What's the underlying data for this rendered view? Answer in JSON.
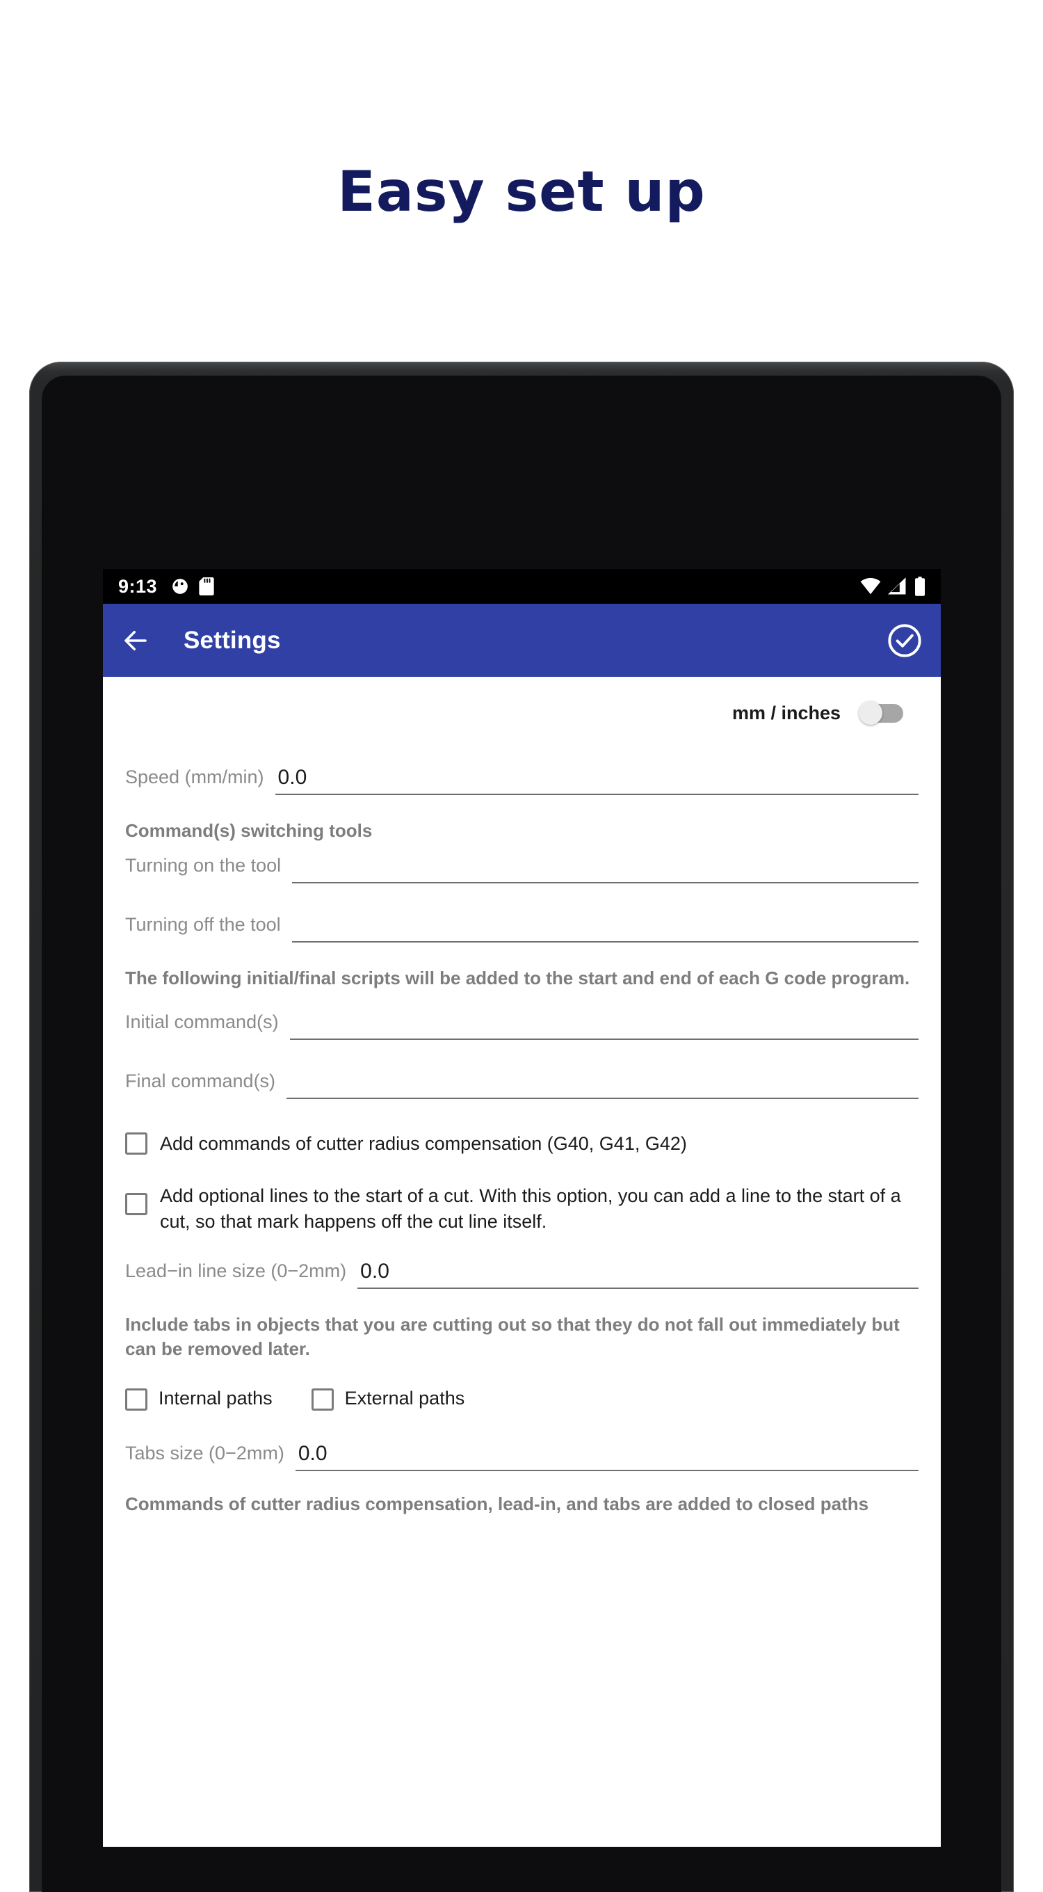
{
  "promo": {
    "headline": "Easy set up"
  },
  "device": {
    "camera_icon": "front-camera"
  },
  "status_bar": {
    "time": "9:13",
    "left_icons": [
      "do-not-disturb-icon",
      "sd-card-icon"
    ],
    "right_icons": [
      "wifi-icon",
      "cellular-signal-icon",
      "battery-icon"
    ]
  },
  "app_bar": {
    "back_icon": "back-arrow-icon",
    "title": "Settings",
    "confirm_icon": "check-circle-icon",
    "background_color": "#3040a5"
  },
  "settings": {
    "units": {
      "label": "mm / inches",
      "toggle_state": "off"
    },
    "speed": {
      "label": "Speed (mm/min)",
      "value": "0.0",
      "placeholder": ""
    },
    "switching_tools_note": "Command(s) switching tools",
    "tool_on": {
      "label": "Turning on the tool",
      "value": "",
      "placeholder": ""
    },
    "tool_off": {
      "label": "Turning off the tool",
      "value": "",
      "placeholder": ""
    },
    "scripts_note": "The following initial/final scripts will be added to the start and end of each G code program.",
    "initial_commands": {
      "label": "Initial command(s)",
      "value": "",
      "placeholder": ""
    },
    "final_commands": {
      "label": "Final command(s)",
      "value": "",
      "placeholder": ""
    },
    "cutter_compensation": {
      "label": "Add commands of cutter radius compensation (G40, G41, G42)",
      "checked": false
    },
    "optional_lines": {
      "label": "Add optional lines to the start of a cut. With this option, you can add a line to the start of a cut, so that mark happens off the cut line itself.",
      "checked": false
    },
    "lead_in": {
      "label": "Lead−in line size (0−2mm)",
      "value": "0.0",
      "placeholder": ""
    },
    "tabs_note": "Include tabs in objects that you are cutting out so that they do not fall out immediately but can be removed later.",
    "internal_paths": {
      "label": "Internal paths",
      "checked": false
    },
    "external_paths": {
      "label": "External paths",
      "checked": false
    },
    "tabs_size": {
      "label": "Tabs size (0−2mm)",
      "value": "0.0",
      "placeholder": ""
    },
    "closed_paths_note": "Commands of cutter radius compensation, lead-in, and tabs are added to closed paths"
  }
}
